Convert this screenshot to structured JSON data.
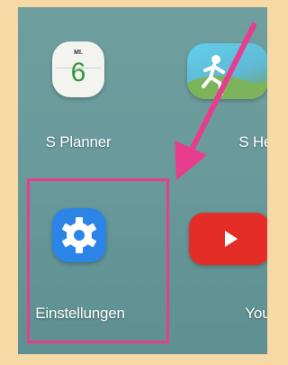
{
  "apps": [
    {
      "name": "S Planner",
      "icon": "calendar-icon",
      "calendar_day": "MI.",
      "calendar_date": "6"
    },
    {
      "name": "S Health",
      "icon": "health-runner-icon"
    },
    {
      "name": "Einstellungen",
      "icon": "gear-icon"
    },
    {
      "name": "YouTube",
      "icon": "play-icon"
    }
  ],
  "colors": {
    "background": "#f6d9a4",
    "highlight": "#e83d8e",
    "settings_blue": "#2b84e6",
    "youtube_red": "#e52d27"
  }
}
